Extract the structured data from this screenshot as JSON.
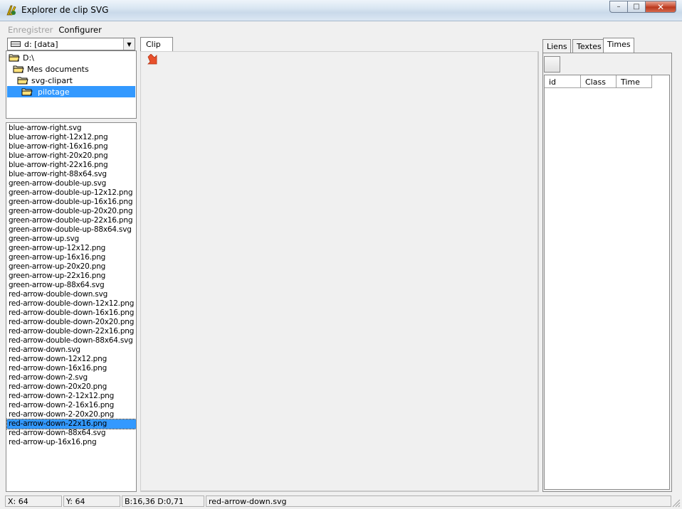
{
  "window": {
    "title": "Explorer de clip SVG",
    "controls": {
      "minimize": "–",
      "maximize": "□",
      "close": "✕"
    }
  },
  "menu": {
    "items": [
      "Enregistrer",
      "Configurer"
    ]
  },
  "drive": {
    "value": "d: [data]"
  },
  "folders": [
    {
      "label": "D:\\",
      "indent": 0
    },
    {
      "label": "Mes documents",
      "indent": 1
    },
    {
      "label": "svg-clipart",
      "indent": 2
    },
    {
      "label": "pilotage",
      "indent": 3,
      "selected": true
    }
  ],
  "files": [
    "blue-arrow-right.svg",
    "blue-arrow-right-12x12.png",
    "blue-arrow-right-16x16.png",
    "blue-arrow-right-20x20.png",
    "blue-arrow-right-22x16.png",
    "blue-arrow-right-88x64.svg",
    "green-arrow-double-up.svg",
    "green-arrow-double-up-12x12.png",
    "green-arrow-double-up-16x16.png",
    "green-arrow-double-up-20x20.png",
    "green-arrow-double-up-22x16.png",
    "green-arrow-double-up-88x64.svg",
    "green-arrow-up.svg",
    "green-arrow-up-12x12.png",
    "green-arrow-up-16x16.png",
    "green-arrow-up-20x20.png",
    "green-arrow-up-22x16.png",
    "green-arrow-up-88x64.svg",
    "red-arrow-double-down.svg",
    "red-arrow-double-down-12x12.png",
    "red-arrow-double-down-16x16.png",
    "red-arrow-double-down-20x20.png",
    "red-arrow-double-down-22x16.png",
    "red-arrow-double-down-88x64.svg",
    "red-arrow-down.svg",
    "red-arrow-down-12x12.png",
    "red-arrow-down-16x16.png",
    "red-arrow-down-2.svg",
    "red-arrow-down-20x20.png",
    "red-arrow-down-2-12x12.png",
    "red-arrow-down-2-16x16.png",
    "red-arrow-down-2-20x20.png",
    "red-arrow-down-22x16.png",
    "red-arrow-down-88x64.svg",
    "red-arrow-up-16x16.png"
  ],
  "selected_file_index": 32,
  "clip": {
    "tab_label": "Clip"
  },
  "right_tabs": {
    "items": [
      "Liens",
      "Textes",
      "Times"
    ],
    "active": "Times"
  },
  "grid": {
    "columns": [
      "id",
      "Class",
      "Time"
    ]
  },
  "status": {
    "x": "X: 64",
    "y": "Y: 64",
    "bd": "B:16,36 D:0,71",
    "file": "red-arrow-down.svg"
  },
  "colors": {
    "selection": "#3399ff",
    "arrow": "#e8502c"
  }
}
